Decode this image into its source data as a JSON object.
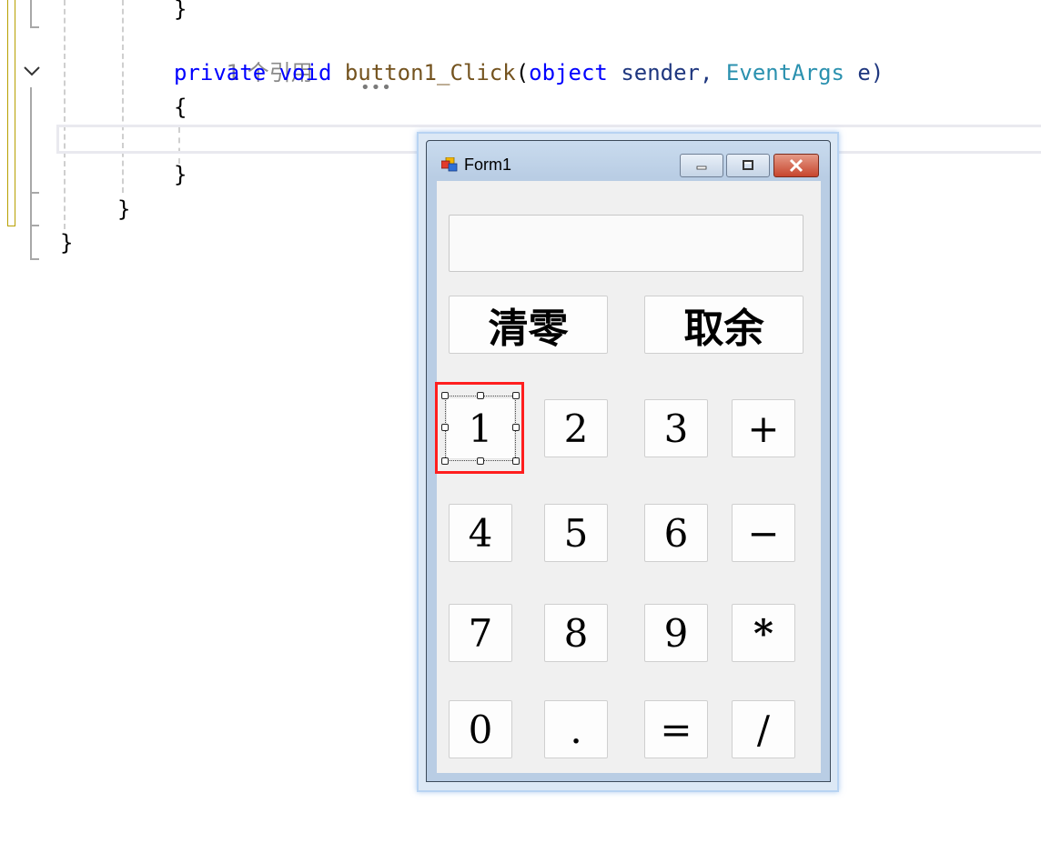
{
  "editor": {
    "lines": {
      "close_brace_top": "}",
      "ref_count": "1 个引用",
      "sig_private": "private",
      "sig_void": "void",
      "sig_method": "button1_Click",
      "sig_open": "(",
      "sig_object": "object",
      "sig_sender": "sender,",
      "sig_type": "EventArgs",
      "sig_e": "e)",
      "open_brace": "{",
      "method_close": "}",
      "class_close": "}",
      "namespace_close": "}"
    }
  },
  "form": {
    "title": "Form1",
    "display_value": "",
    "buttons": {
      "clear": "清零",
      "mod": "取余",
      "b1": "1",
      "b2": "2",
      "b3": "3",
      "plus": "+",
      "b4": "4",
      "b5": "5",
      "b6": "6",
      "minus": "−",
      "b7": "7",
      "b8": "8",
      "b9": "9",
      "mul": "*",
      "b0": "0",
      "dot": ".",
      "eq": "=",
      "div": "/"
    }
  },
  "colors": {
    "keyword": "#0000ff",
    "method": "#74531f",
    "type": "#2b91af",
    "selection": "#ff1e1e"
  }
}
